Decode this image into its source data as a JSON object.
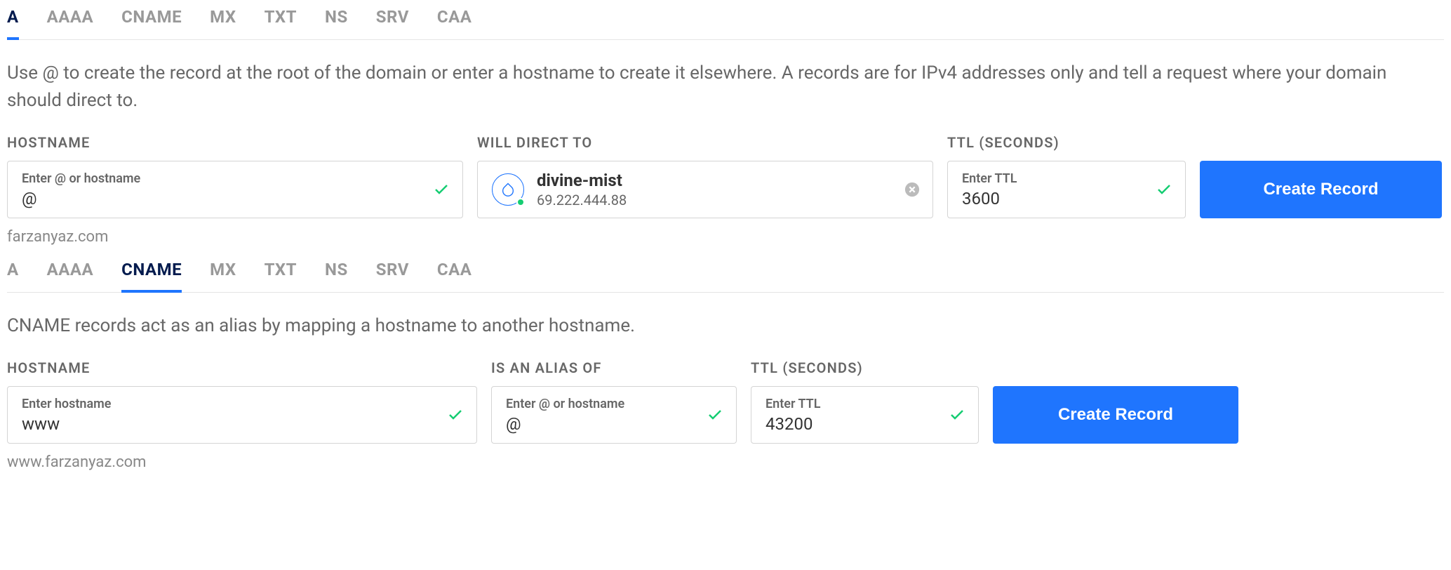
{
  "section1": {
    "tabs": [
      "A",
      "AAAA",
      "CNAME",
      "MX",
      "TXT",
      "NS",
      "SRV",
      "CAA"
    ],
    "active_tab_index": 0,
    "description": "Use @ to create the record at the root of the domain or enter a hostname to create it elsewhere. A records are for IPv4 addresses only and tell a request where your domain should direct to.",
    "hostname": {
      "label": "HOSTNAME",
      "placeholder": "Enter @ or hostname",
      "value": "@",
      "helper": "farzanyaz.com"
    },
    "direct_to": {
      "label": "WILL DIRECT TO",
      "resource_name": "divine-mist",
      "resource_ip": "69.222.444.88"
    },
    "ttl": {
      "label": "TTL (SECONDS)",
      "placeholder": "Enter TTL",
      "value": "3600"
    },
    "button": "Create Record"
  },
  "section2": {
    "tabs": [
      "A",
      "AAAA",
      "CNAME",
      "MX",
      "TXT",
      "NS",
      "SRV",
      "CAA"
    ],
    "active_tab_index": 2,
    "description": "CNAME records act as an alias by mapping a hostname to another hostname.",
    "hostname": {
      "label": "HOSTNAME",
      "placeholder": "Enter hostname",
      "value": "www",
      "helper": "www.farzanyaz.com"
    },
    "alias": {
      "label": "IS AN ALIAS OF",
      "placeholder": "Enter @ or hostname",
      "value": "@"
    },
    "ttl": {
      "label": "TTL (SECONDS)",
      "placeholder": "Enter TTL",
      "value": "43200"
    },
    "button": "Create Record"
  }
}
